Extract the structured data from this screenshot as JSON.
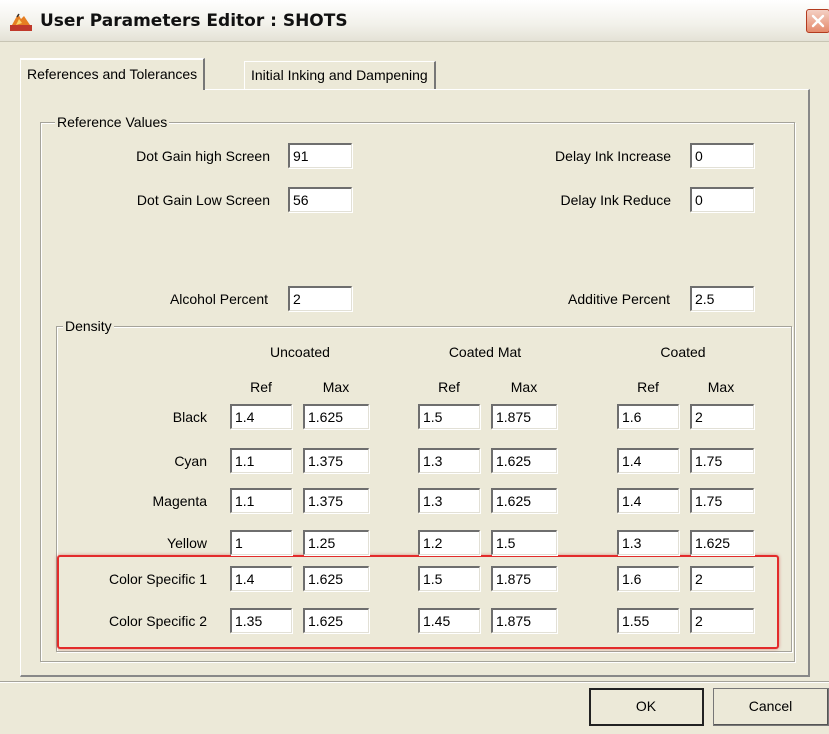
{
  "window": {
    "title": "User Parameters Editor : SHOTS",
    "app_icon": "app-logo-icon",
    "close_icon": "close-icon"
  },
  "tabs": [
    {
      "label": "References and Tolerances",
      "active": true
    },
    {
      "label": "Initial Inking and Dampening",
      "active": false
    }
  ],
  "reference_values": {
    "legend": "Reference Values",
    "dot_gain_high": {
      "label": "Dot Gain high Screen",
      "value": "91"
    },
    "dot_gain_low": {
      "label": "Dot Gain Low Screen",
      "value": "56"
    },
    "delay_ink_increase": {
      "label": "Delay Ink Increase",
      "value": "0"
    },
    "delay_ink_reduce": {
      "label": "Delay Ink Reduce",
      "value": "0"
    },
    "alcohol_percent": {
      "label": "Alcohol Percent",
      "value": "2"
    },
    "additive_percent": {
      "label": "Additive Percent",
      "value": "2.5"
    }
  },
  "density": {
    "legend": "Density",
    "groups": [
      "Uncoated",
      "Coated Mat",
      "Coated"
    ],
    "ref_label": "Ref",
    "max_label": "Max",
    "rows": [
      {
        "label": "Black",
        "values": [
          "1.4",
          "1.625",
          "1.5",
          "1.875",
          "1.6",
          "2"
        ]
      },
      {
        "label": "Cyan",
        "values": [
          "1.1",
          "1.375",
          "1.3",
          "1.625",
          "1.4",
          "1.75"
        ]
      },
      {
        "label": "Magenta",
        "values": [
          "1.1",
          "1.375",
          "1.3",
          "1.625",
          "1.4",
          "1.75"
        ]
      },
      {
        "label": "Yellow",
        "values": [
          "1",
          "1.25",
          "1.2",
          "1.5",
          "1.3",
          "1.625"
        ]
      },
      {
        "label": "Color Specific 1",
        "values": [
          "1.4",
          "1.625",
          "1.5",
          "1.875",
          "1.6",
          "2"
        ]
      },
      {
        "label": "Color Specific 2",
        "values": [
          "1.35",
          "1.625",
          "1.45",
          "1.875",
          "1.55",
          "2"
        ]
      }
    ]
  },
  "buttons": {
    "ok": "OK",
    "cancel": "Cancel"
  },
  "colors": {
    "highlight": "#e32b2b",
    "dialog_bg": "#ece9d8"
  }
}
